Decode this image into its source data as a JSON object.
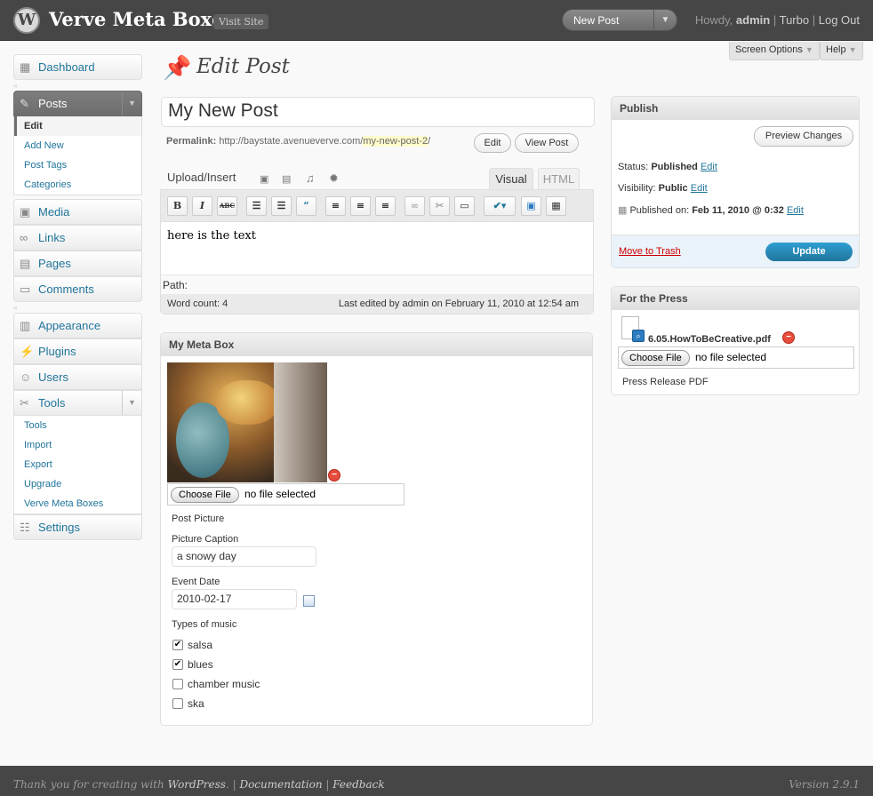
{
  "header": {
    "site_title": "Verve Meta Boxes",
    "visit_site": "Visit Site",
    "favorite_action": "New Post",
    "howdy": "Howdy,",
    "user": "admin",
    "turbo": "Turbo",
    "logout": "Log Out"
  },
  "screen_options": "Screen Options",
  "help": "Help",
  "menu": {
    "dashboard": "Dashboard",
    "posts": "Posts",
    "posts_sub": [
      "Edit",
      "Add New",
      "Post Tags",
      "Categories"
    ],
    "media": "Media",
    "links": "Links",
    "pages": "Pages",
    "comments": "Comments",
    "appearance": "Appearance",
    "plugins": "Plugins",
    "users": "Users",
    "tools": "Tools",
    "tools_sub": [
      "Tools",
      "Import",
      "Export",
      "Upgrade",
      "Verve Meta Boxes"
    ],
    "settings": "Settings"
  },
  "page_title": "Edit Post",
  "post": {
    "title": "My New Post",
    "permalink_label": "Permalink:",
    "permalink_base": "http://baystate.avenueverve.com/",
    "permalink_slug": "my-new-post-2",
    "permalink_end": "/",
    "edit_button": "Edit",
    "view_post_button": "View Post"
  },
  "editor": {
    "upload_insert": "Upload/Insert",
    "tab_visual": "Visual",
    "tab_html": "HTML",
    "toolbar": [
      "B",
      "I",
      "ABC"
    ],
    "content": "here is the text",
    "path": "Path:",
    "word_count": "Word count: 4",
    "last_edited": "Last edited by admin on February 11, 2010 at 12:54 am"
  },
  "meta_box": {
    "title": "My Meta Box",
    "choose_file": "Choose File",
    "no_file": "no file selected",
    "post_picture": "Post Picture",
    "caption_label": "Picture Caption",
    "caption_value": "a snowy day",
    "date_label": "Event Date",
    "date_value": "2010-02-17",
    "music_label": "Types of music",
    "music": [
      {
        "label": "salsa",
        "checked": true
      },
      {
        "label": "blues",
        "checked": true
      },
      {
        "label": "chamber music",
        "checked": false
      },
      {
        "label": "ska",
        "checked": false
      }
    ]
  },
  "publish": {
    "title": "Publish",
    "preview": "Preview Changes",
    "status_label": "Status:",
    "status_value": "Published",
    "visibility_label": "Visibility:",
    "visibility_value": "Public",
    "published_on_label": "Published on:",
    "published_on_value": "Feb 11, 2010 @ 0:32",
    "edit": "Edit",
    "trash": "Move to Trash",
    "update": "Update"
  },
  "press": {
    "title": "For the Press",
    "filename": "6.05.HowToBeCreative.pdf",
    "choose_file": "Choose File",
    "no_file": "no file selected",
    "label": "Press Release PDF"
  },
  "footer": {
    "thanks": "Thank you for creating with",
    "wordpress": "WordPress",
    "documentation": "Documentation",
    "feedback": "Feedback",
    "version": "Version 2.9.1"
  }
}
